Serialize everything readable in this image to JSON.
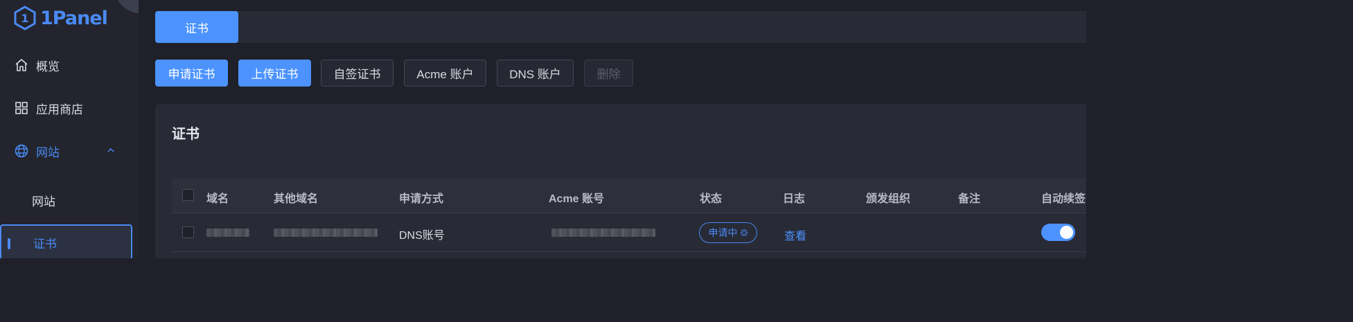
{
  "app": {
    "logo_text": "1Panel"
  },
  "sidebar": {
    "items": [
      {
        "label": "概览",
        "icon": "home-icon"
      },
      {
        "label": "应用商店",
        "icon": "grid-icon"
      },
      {
        "label": "网站",
        "icon": "globe-icon",
        "expanded": true
      }
    ],
    "sub_items": [
      {
        "label": "网站"
      },
      {
        "label": "证书",
        "selected": true
      }
    ]
  },
  "tabs": [
    {
      "label": "证书",
      "active": true
    }
  ],
  "toolbar": {
    "apply_label": "申请证书",
    "upload_label": "上传证书",
    "selfsign_label": "自签证书",
    "acme_label": "Acme 账户",
    "dns_label": "DNS 账户",
    "delete_label": "删除"
  },
  "card": {
    "title": "证书"
  },
  "table": {
    "columns": [
      "域名",
      "其他域名",
      "申请方式",
      "Acme 账号",
      "状态",
      "日志",
      "颁发组织",
      "备注",
      "自动续签"
    ],
    "rows": [
      {
        "method": "DNS账号",
        "status": "申请中",
        "log_link": "查看",
        "auto_renew": true
      }
    ]
  },
  "colors": {
    "accent": "#4c93ff",
    "background": "#1f2029",
    "panel": "#282a36"
  }
}
